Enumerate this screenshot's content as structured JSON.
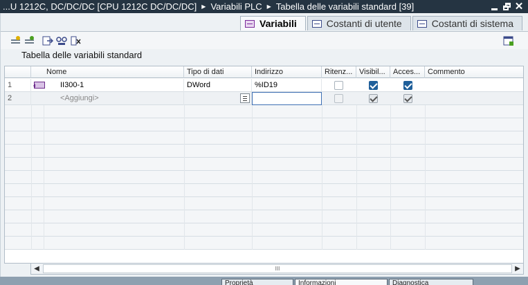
{
  "titlebar": {
    "crumbs": [
      "...U 1212C, DC/DC/DC [CPU 1212C DC/DC/DC]",
      "Variabili PLC",
      "Tabella delle variabili standard [39]"
    ]
  },
  "tabs": [
    {
      "label": "Variabili",
      "active": true
    },
    {
      "label": "Costanti di utente",
      "active": false
    },
    {
      "label": "Costanti di sistema",
      "active": false
    }
  ],
  "table": {
    "title": "Tabella delle variabili standard",
    "columns": [
      "Nome",
      "Tipo di dati",
      "Indirizzo",
      "Ritenz...",
      "Visibil...",
      "Acces...",
      "Commento"
    ],
    "rows": [
      {
        "num": "1",
        "name": "II300-1",
        "type": "DWord",
        "address": "%ID19",
        "retain": false,
        "visible": true,
        "accessible": true,
        "comment": ""
      },
      {
        "num": "2",
        "name": "<Aggiungi>",
        "type": "",
        "address": "",
        "retain": false,
        "visible": true,
        "accessible": true,
        "comment": ""
      }
    ]
  },
  "scrollbar": {
    "thumb_label": "III"
  },
  "bottom_tabs": [
    "Proprietà",
    "Informazioni",
    "Diagnostica"
  ],
  "colors": {
    "titlebar": "#253442",
    "accent": "#1f5f9a",
    "tag": "#6b2a8a"
  }
}
